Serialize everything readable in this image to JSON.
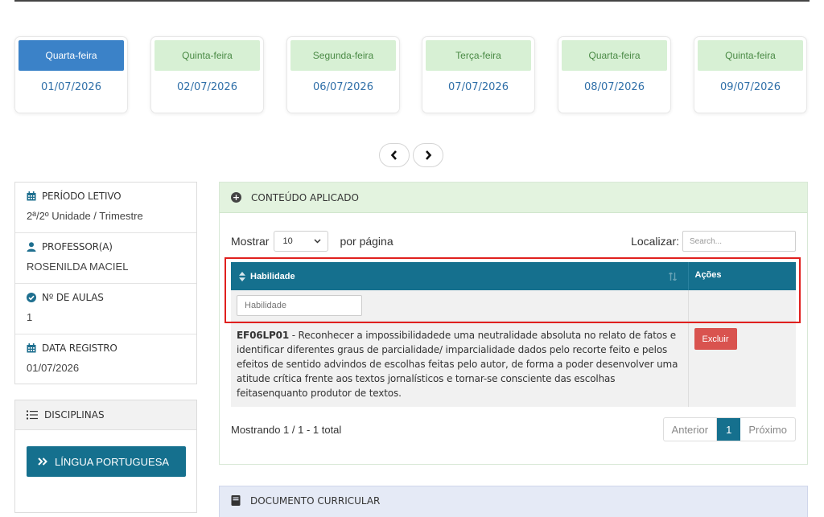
{
  "days": [
    {
      "weekday": "Quarta-feira",
      "date": "01/07/2026",
      "active": true
    },
    {
      "weekday": "Quinta-feira",
      "date": "02/07/2026",
      "active": false
    },
    {
      "weekday": "Segunda-feira",
      "date": "06/07/2026",
      "active": false
    },
    {
      "weekday": "Terça-feira",
      "date": "07/07/2026",
      "active": false
    },
    {
      "weekday": "Quarta-feira",
      "date": "08/07/2026",
      "active": false
    },
    {
      "weekday": "Quinta-feira",
      "date": "09/07/2026",
      "active": false
    }
  ],
  "nav": {
    "prev_icon": "chevron-left-icon",
    "next_icon": "chevron-right-icon"
  },
  "info": {
    "periodo_label": "PERÍODO LETIVO",
    "periodo_value": "2ª/2º Unidade / Trimestre",
    "professor_label": "PROFESSOR(A)",
    "professor_value": "ROSENILDA MACIEL",
    "aulas_label": "Nº DE AULAS",
    "aulas_value": "1",
    "registro_label": "DATA REGISTRO",
    "registro_value": "01/07/2026"
  },
  "disciplinas": {
    "title": "DISCIPLINAS",
    "button_label": "LÍNGUA PORTUGUESA"
  },
  "conteudo": {
    "title": "CONTEÚDO APLICADO",
    "show_label": "Mostrar",
    "per_page_value": "10",
    "per_page_label": "por página",
    "search_label": "Localizar:",
    "search_placeholder": "Search...",
    "columns": {
      "habilidade": "Habilidade",
      "acoes": "Ações"
    },
    "filter_placeholder": "Habilidade",
    "row": {
      "code": "EF06LP01",
      "text": " - Reconhecer a impossibilidadede uma neutralidade absoluta no relato de fatos e identificar diferentes graus de parcialidade/ imparcialidade dados pelo recorte feito e pelos efeitos de sentido advindos de escolhas feitas pelo autor, de forma a poder desenvolver uma atitude crítica frente aos textos jornalísticos e tornar-se consciente das escolhas feitasenquanto produtor de textos.",
      "delete_label": "Excluir"
    },
    "summary": "Mostrando 1 / 1 - 1 total",
    "pagination": {
      "prev": "Anterior",
      "current": "1",
      "next": "Próximo"
    }
  },
  "documento": {
    "title": "DOCUMENTO CURRICULAR"
  },
  "colors": {
    "primary": "#15708e",
    "active_day": "#3b82c8",
    "day_header": "#d7f0d4",
    "danger": "#d9534f",
    "highlight": "#e0201e"
  }
}
